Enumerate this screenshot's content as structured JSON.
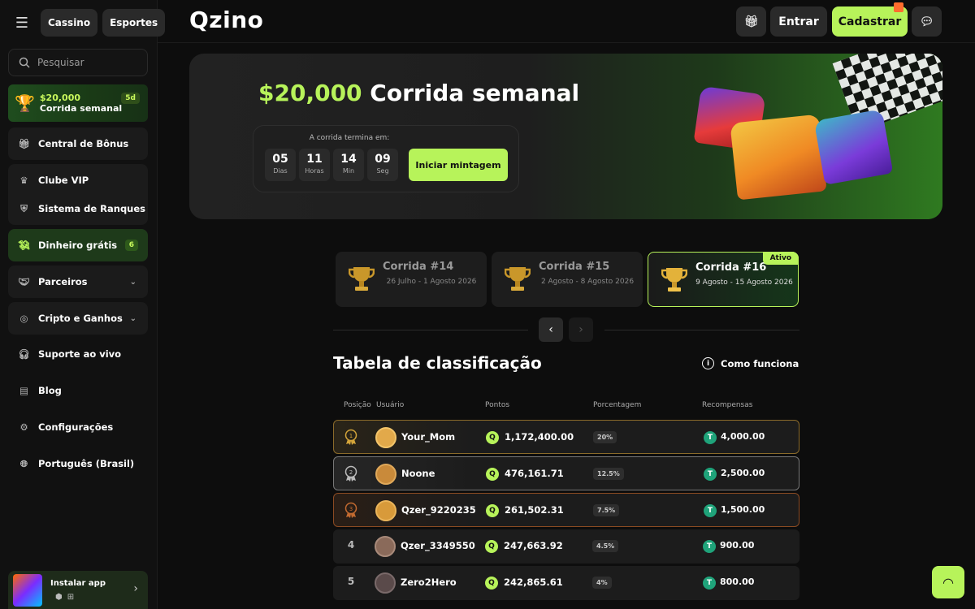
{
  "header": {
    "categories": [
      "Cassino",
      "Esportes"
    ],
    "logo": "Qzino",
    "login": "Entrar",
    "signup": "Cadastrar"
  },
  "search": {
    "placeholder": "Pesquisar"
  },
  "promo": {
    "amount": "$20,000",
    "label": "Corrida semanal",
    "badge": "5d"
  },
  "sidebar": {
    "bonus": "Central de Bônus",
    "vip": "Clube VIP",
    "ranks": "Sistema de Ranques",
    "free_money": "Dinheiro grátis",
    "free_money_count": "6",
    "partners": "Parceiros",
    "crypto": "Cripto e Ganhos",
    "support": "Suporte ao vivo",
    "blog": "Blog",
    "settings": "Configurações",
    "language": "Português (Brasil)",
    "install": "Instalar app"
  },
  "banner": {
    "amount": "$20,000",
    "title": "Corrida semanal",
    "ends_caption": "A corrida termina em:",
    "countdown": [
      {
        "value": "05",
        "unit": "Dias"
      },
      {
        "value": "11",
        "unit": "Horas"
      },
      {
        "value": "14",
        "unit": "Min"
      },
      {
        "value": "09",
        "unit": "Seg"
      }
    ],
    "cta": "Iniciar mintagem"
  },
  "races": [
    {
      "title": "Corrida #14",
      "dates": "26 Julho - 1 Agosto 2026",
      "active": false
    },
    {
      "title": "Corrida #15",
      "dates": "2 Agosto - 8 Agosto 2026",
      "active": false
    },
    {
      "title": "Corrida #16",
      "dates": "9 Agosto - 15 Agosto 2026",
      "active": true,
      "tag": "Ativo"
    }
  ],
  "leaderboard": {
    "title": "Tabela de classificação",
    "how_it_works": "Como funciona",
    "columns": [
      "Posição",
      "Usuário",
      "Pontos",
      "Porcentagem",
      "Recompensas"
    ],
    "rows": [
      {
        "pos": "1",
        "user": "Your_Mom",
        "points": "1,172,400.00",
        "pct": "20%",
        "reward": "4,000.00"
      },
      {
        "pos": "2",
        "user": "Noone",
        "points": "476,161.71",
        "pct": "12.5%",
        "reward": "2,500.00"
      },
      {
        "pos": "3",
        "user": "Qzer_9220235",
        "points": "261,502.31",
        "pct": "7.5%",
        "reward": "1,500.00"
      },
      {
        "pos": "4",
        "user": "Qzer_3349550",
        "points": "247,663.92",
        "pct": "4.5%",
        "reward": "900.00"
      },
      {
        "pos": "5",
        "user": "Zero2Hero",
        "points": "242,865.61",
        "pct": "4%",
        "reward": "800.00"
      }
    ]
  },
  "colors": {
    "accent": "#b7f35a",
    "reward": "#1fa37a"
  }
}
